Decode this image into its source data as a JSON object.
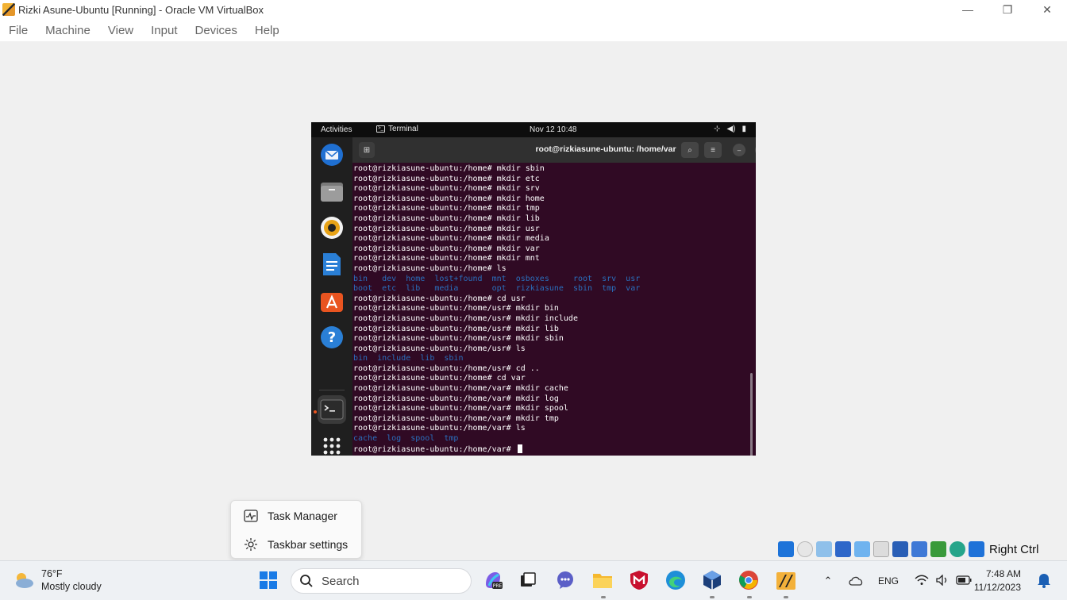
{
  "window": {
    "title": "Rizki Asune-Ubuntu [Running] - Oracle VM VirtualBox",
    "controls": {
      "minimize": "—",
      "restore": "❐",
      "close": "✕"
    }
  },
  "menubar": [
    "File",
    "Machine",
    "View",
    "Input",
    "Devices",
    "Help"
  ],
  "guest": {
    "topbar": {
      "activities": "Activities",
      "app_name": "Terminal",
      "clock": "Nov 12  10:48"
    },
    "terminal": {
      "title": "root@rizkiasune-ubuntu: /home/var",
      "lines": [
        {
          "text": "root@rizkiasune-ubuntu:/home# mkdir sbin",
          "type": "cmd"
        },
        {
          "text": "root@rizkiasune-ubuntu:/home# mkdir etc",
          "type": "cmd"
        },
        {
          "text": "root@rizkiasune-ubuntu:/home# mkdir srv",
          "type": "cmd"
        },
        {
          "text": "root@rizkiasune-ubuntu:/home# mkdir home",
          "type": "cmd"
        },
        {
          "text": "root@rizkiasune-ubuntu:/home# mkdir tmp",
          "type": "cmd"
        },
        {
          "text": "root@rizkiasune-ubuntu:/home# mkdir lib",
          "type": "cmd"
        },
        {
          "text": "root@rizkiasune-ubuntu:/home# mkdir usr",
          "type": "cmd"
        },
        {
          "text": "root@rizkiasune-ubuntu:/home# mkdir media",
          "type": "cmd"
        },
        {
          "text": "root@rizkiasune-ubuntu:/home# mkdir var",
          "type": "cmd"
        },
        {
          "text": "root@rizkiasune-ubuntu:/home# mkdir mnt",
          "type": "cmd"
        },
        {
          "text": "root@rizkiasune-ubuntu:/home# ls",
          "type": "cmd"
        },
        {
          "text": "bin   dev  home  lost+found  mnt  osboxes     root  srv  usr",
          "type": "dir"
        },
        {
          "text": "boot  etc  lib   media       opt  rizkiasune  sbin  tmp  var",
          "type": "dir"
        },
        {
          "text": "root@rizkiasune-ubuntu:/home# cd usr",
          "type": "cmd"
        },
        {
          "text": "root@rizkiasune-ubuntu:/home/usr# mkdir bin",
          "type": "cmd"
        },
        {
          "text": "root@rizkiasune-ubuntu:/home/usr# mkdir include",
          "type": "cmd"
        },
        {
          "text": "root@rizkiasune-ubuntu:/home/usr# mkdir lib",
          "type": "cmd"
        },
        {
          "text": "root@rizkiasune-ubuntu:/home/usr# mkdir sbin",
          "type": "cmd"
        },
        {
          "text": "root@rizkiasune-ubuntu:/home/usr# ls",
          "type": "cmd"
        },
        {
          "text": "bin  include  lib  sbin",
          "type": "dir"
        },
        {
          "text": "root@rizkiasune-ubuntu:/home/usr# cd ..",
          "type": "cmd"
        },
        {
          "text": "root@rizkiasune-ubuntu:/home# cd var",
          "type": "cmd"
        },
        {
          "text": "root@rizkiasune-ubuntu:/home/var# mkdir cache",
          "type": "cmd"
        },
        {
          "text": "root@rizkiasune-ubuntu:/home/var# mkdir log",
          "type": "cmd"
        },
        {
          "text": "root@rizkiasune-ubuntu:/home/var# mkdir spool",
          "type": "cmd"
        },
        {
          "text": "root@rizkiasune-ubuntu:/home/var# mkdir tmp",
          "type": "cmd"
        },
        {
          "text": "root@rizkiasune-ubuntu:/home/var# ls",
          "type": "cmd"
        },
        {
          "text": "cache  log  spool  tmp",
          "type": "dir"
        }
      ],
      "prompt": "root@rizkiasune-ubuntu:/home/var# "
    },
    "dock": [
      "thunderbird-icon",
      "files-icon",
      "rhythmbox-icon",
      "writer-icon",
      "app-center-icon",
      "help-icon",
      "terminal-icon",
      "show-apps-icon"
    ]
  },
  "context_menu": [
    {
      "label": "Task Manager",
      "icon": "task-manager-icon"
    },
    {
      "label": "Taskbar settings",
      "icon": "gear-icon"
    }
  ],
  "vb_status": {
    "host_key": "Right Ctrl"
  },
  "taskbar": {
    "weather": {
      "temp": "76°F",
      "condition": "Mostly cloudy"
    },
    "search_placeholder": "Search",
    "tray": {
      "language": "ENG"
    },
    "clock": {
      "time": "7:48 AM",
      "date": "11/12/2023"
    }
  },
  "colors": {
    "terminal_bg": "#300a24",
    "dir_blue": "#2a6fbd",
    "ubuntu_orange": "#e95420"
  }
}
